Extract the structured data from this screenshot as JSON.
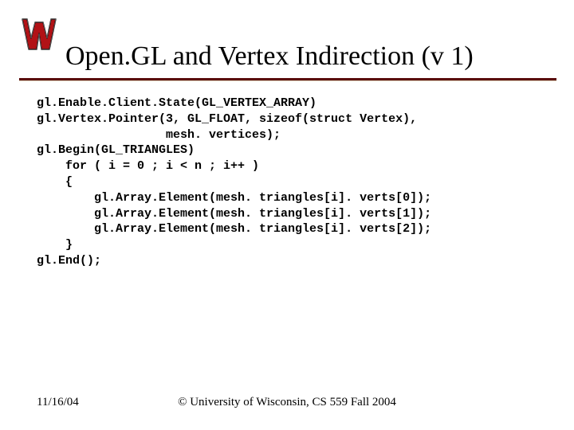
{
  "logo": {
    "name": "wisconsin-w-logo"
  },
  "title": "Open.GL and Vertex Indirection (v 1)",
  "code": "gl.Enable.Client.State(GL_VERTEX_ARRAY)\ngl.Vertex.Pointer(3, GL_FLOAT, sizeof(struct Vertex),\n                  mesh. vertices);\ngl.Begin(GL_TRIANGLES)\n    for ( i = 0 ; i < n ; i++ )\n    {\n        gl.Array.Element(mesh. triangles[i]. verts[0]);\n        gl.Array.Element(mesh. triangles[i]. verts[1]);\n        gl.Array.Element(mesh. triangles[i]. verts[2]);\n    }\ngl.End();",
  "footer": {
    "date": "11/16/04",
    "copyright": "© University of Wisconsin, CS 559 Fall 2004"
  }
}
